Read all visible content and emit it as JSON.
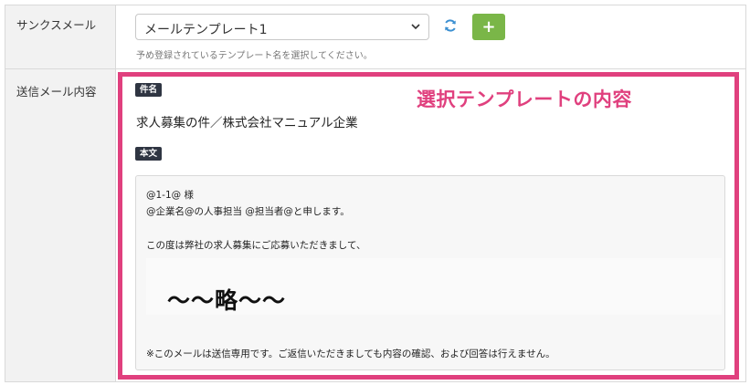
{
  "thanks_mail": {
    "label": "サンクスメール",
    "template_select": {
      "selected": "メールテンプレート1"
    },
    "help_text": "予め登録されているテンプレート名を選択してください。",
    "add_button_label": "+"
  },
  "send_content": {
    "label": "送信メール内容",
    "callout": "選択テンプレートの内容",
    "subject_badge": "件名",
    "subject": "求人募集の件／株式会社マニュアル企業",
    "body_badge": "本文",
    "body_lines": [
      "@1-1@ 様",
      "@企業名@の人事担当 @担当者@と申します。",
      "この度は弊社の求人募集にご応募いただきまして、",
      "〜〜略〜〜",
      "※このメールは送信専用です。ご返信いただきましても内容の確認、および回答は行えません。"
    ]
  },
  "colors": {
    "accent": "#e0407e",
    "add_button": "#7ab648",
    "refresh_icon": "#3b8fd1",
    "badge": "#2f3542"
  },
  "icons": [
    "chevron-down-icon",
    "refresh-icon",
    "plus-icon"
  ]
}
